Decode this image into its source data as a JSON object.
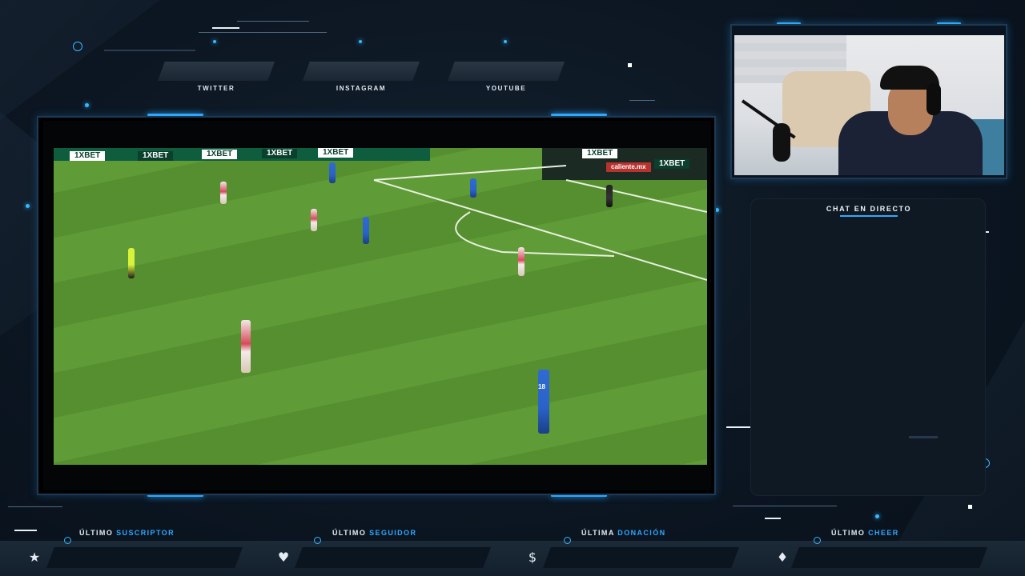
{
  "social": [
    {
      "label": "TWITTER"
    },
    {
      "label": "INSTAGRAM"
    },
    {
      "label": "YOUTUBE"
    }
  ],
  "chat": {
    "title": "CHAT EN DIRECTO"
  },
  "game": {
    "adboards": [
      "1XBET",
      "1XBET",
      "1XBET",
      "1XBET",
      "1XBET",
      "1XBET",
      "1XBET",
      "caliente.mx"
    ],
    "jersey_number": "18"
  },
  "bottom_bars": [
    {
      "prefix": "ÚLTIMO",
      "highlight": "SUSCRIPTOR",
      "icon": "star-icon",
      "glyph": "★"
    },
    {
      "prefix": "ÚLTIMO",
      "highlight": "SEGUIDOR",
      "icon": "heart-icon",
      "glyph": "♥"
    },
    {
      "prefix": "ÚLTIMA",
      "highlight": "DONACIÓN",
      "icon": "dollar-icon",
      "glyph": "$"
    },
    {
      "prefix": "ÚLTIMO",
      "highlight": "CHEER",
      "icon": "diamond-icon",
      "glyph": "♦"
    }
  ],
  "colors": {
    "accent": "#2fa8ff",
    "background": "#0c1622",
    "pitch": "#5f9b36"
  }
}
